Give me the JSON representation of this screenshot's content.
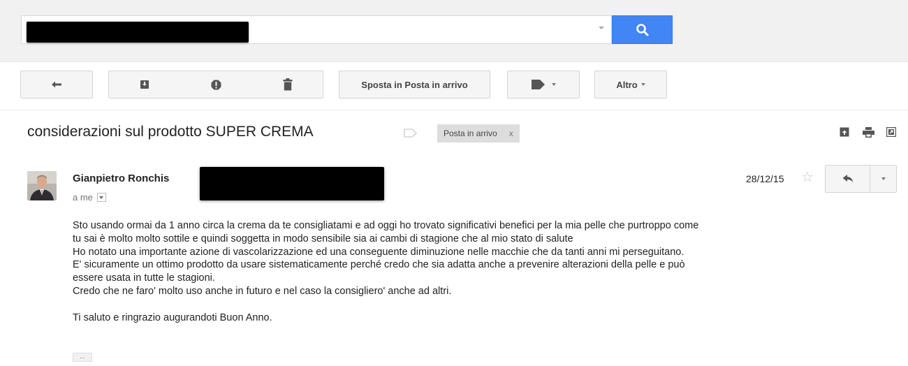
{
  "search": {
    "value": "",
    "placeholder": ""
  },
  "toolbar": {
    "back_icon": "back-arrow-icon",
    "archive_icon": "archive-icon",
    "spam_icon": "report-spam-icon",
    "delete_icon": "trash-icon",
    "move_to_inbox_label": "Sposta in Posta in arrivo",
    "labels_icon": "label-tag-icon",
    "more_label": "Altro"
  },
  "email": {
    "subject": "considerazioni sul prodotto SUPER CREMA",
    "label_chip": "Posta in arrivo",
    "label_chip_remove": "x",
    "sender_name": "Gianpietro Ronchis",
    "recipient": "a me",
    "date": "28/12/15",
    "body_lines": [
      "Sto usando ormai da 1 anno circa la crema da te consigliatami e ad oggi ho trovato significativi benefici per la mia pelle che purtroppo come",
      "tu sai è molto molto sottile e quindi soggetta in modo sensibile sia ai cambi di stagione che al mio stato di salute",
      "Ho notato una importante azione di vascolarizzazione ed una conseguente diminuzione nelle macchie che da tanti anni mi perseguitano.",
      "E' sicuramente un ottimo prodotto da usare sistematicamente perché credo che sia adatta anche a prevenire alterazioni della pelle e può",
      "essere usata in tutte le stagioni.",
      "Credo che ne faro' molto uso anche in futuro e nel caso la consigliero' anche ad altri."
    ],
    "closing": "Ti saluto e ringrazio augurandoti Buon Anno.",
    "trimmed_content": "..."
  },
  "colors": {
    "search_button": "#4285f4",
    "topbar_bg": "#f1f1f1",
    "chip_bg": "#dddddd"
  }
}
